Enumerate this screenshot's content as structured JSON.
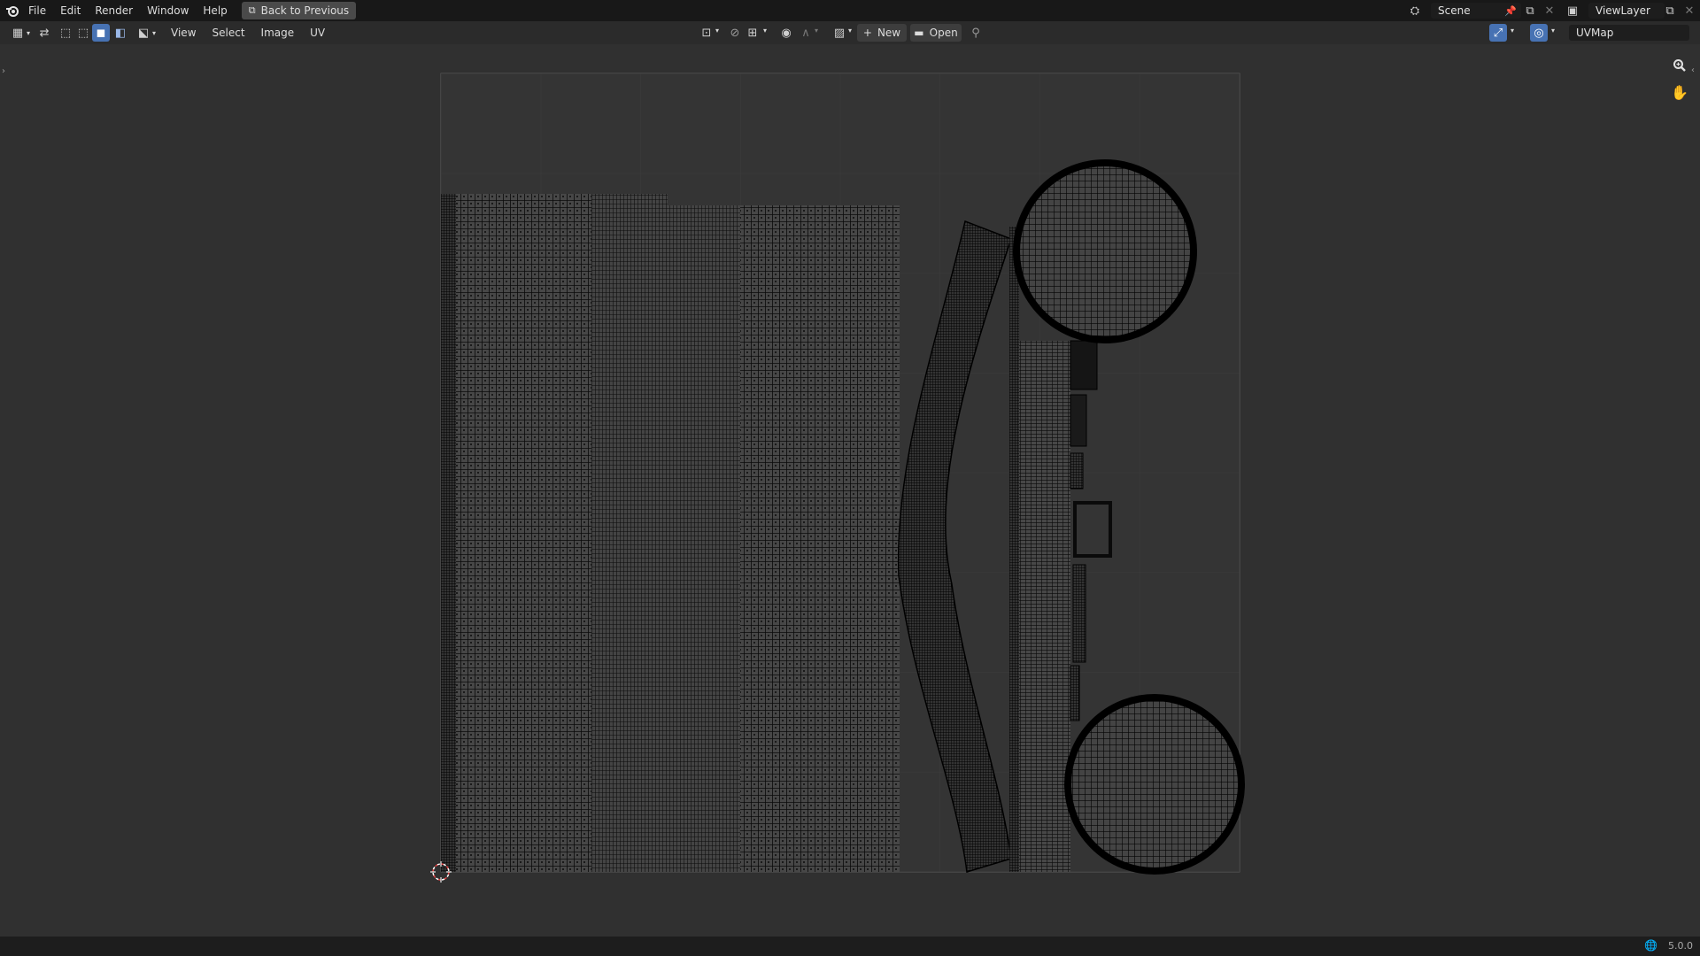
{
  "app": {
    "logo_icon": "blender-logo-icon"
  },
  "topbar": {
    "menus": [
      "File",
      "Edit",
      "Render",
      "Window",
      "Help"
    ],
    "back_button": "Back to Previous",
    "scene_name": "Scene",
    "view_layer_name": "ViewLayer"
  },
  "header": {
    "editor_menus": [
      "View",
      "Select",
      "Image",
      "UV"
    ],
    "new_label": "New",
    "open_label": "Open",
    "uv_map_name": "UVMap"
  },
  "status": {
    "version": "5.0.0"
  },
  "colors": {
    "background": "#303030",
    "topbar": "#181818",
    "header": "#2b2b2b",
    "accent": "#4772b3",
    "uv_wire": "#000000",
    "uv_face": "#454545",
    "cursor": "#e04040"
  }
}
